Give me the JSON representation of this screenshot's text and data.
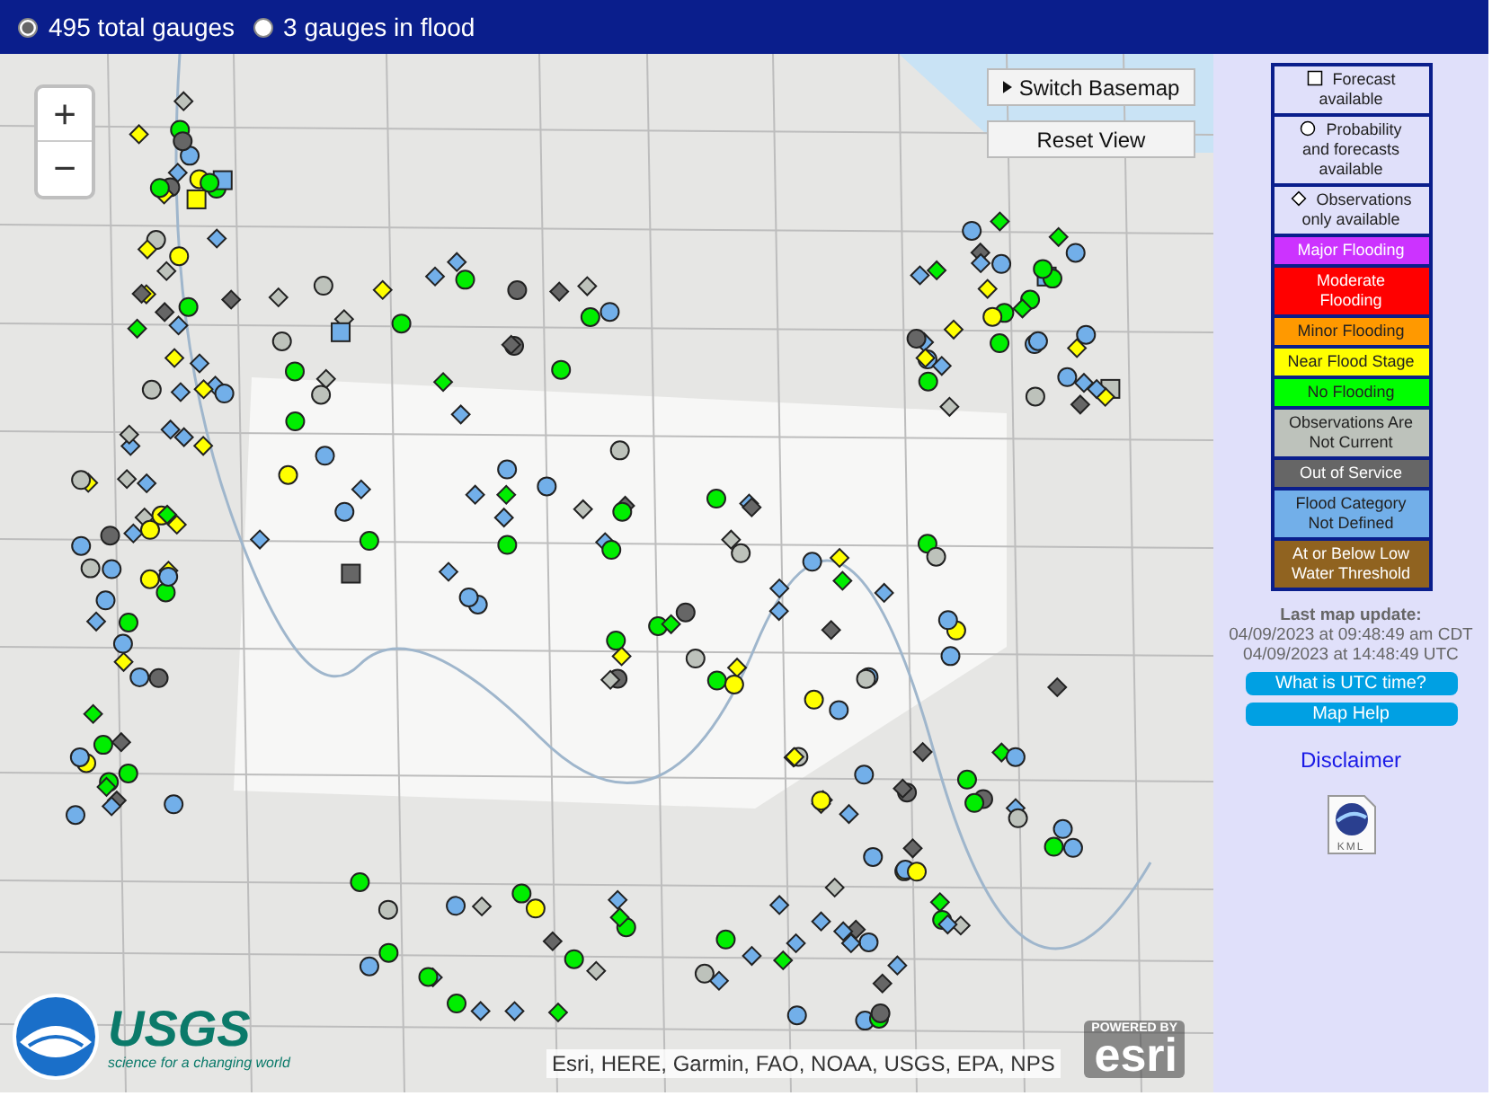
{
  "header": {
    "filters": [
      {
        "label": "495 total gauges",
        "selected": true
      },
      {
        "label": "3 gauges in flood",
        "selected": false
      }
    ]
  },
  "map": {
    "zoom": [
      {
        "kind": "in",
        "label": "+"
      },
      {
        "kind": "out",
        "label": "−"
      }
    ],
    "buttons": [
      {
        "kind": "menu",
        "label": "Switch Basemap"
      },
      {
        "kind": "plain",
        "label": "Reset View"
      }
    ],
    "attribution": "Esri, HERE, Garmin, FAO, NOAA, USGS, EPA, NPS",
    "usgs": {
      "name": "USGS",
      "tagline": "science for a changing world"
    },
    "esri": {
      "powered": "POWERED BY",
      "name": "esri"
    }
  },
  "legend": {
    "shapes": [
      {
        "kind": "square",
        "label": "Forecast available"
      },
      {
        "kind": "circle",
        "label": "Probability and forecasts available"
      },
      {
        "kind": "diamond",
        "label": "Observations only available"
      }
    ],
    "categories": [
      {
        "label": "Major Flooding",
        "color": "#cc33ff"
      },
      {
        "label": "Moderate Flooding",
        "color": "#ff0000"
      },
      {
        "label": "Minor Flooding",
        "color": "#ff9900"
      },
      {
        "label": "Near Flood Stage",
        "color": "#ffff00"
      },
      {
        "label": "No Flooding",
        "color": "#00ff00"
      },
      {
        "label": "Observations Are Not Current",
        "color": "#bdc2bb"
      },
      {
        "label": "Out of Service",
        "color": "#666666"
      },
      {
        "label": "Flood Category Not Defined",
        "color": "#72afe9"
      },
      {
        "label": "At or Below Low Water Threshold",
        "color": "#906320"
      }
    ]
  },
  "update": {
    "title": "Last map update:",
    "local": "04/09/2023 at 09:48:49 am CDT",
    "utc": "04/09/2023 at 14:48:49 UTC"
  },
  "links": [
    {
      "label": "What is UTC time?"
    },
    {
      "label": "Map Help"
    }
  ],
  "disclaimer": "Disclaimer",
  "kml": "KML"
}
